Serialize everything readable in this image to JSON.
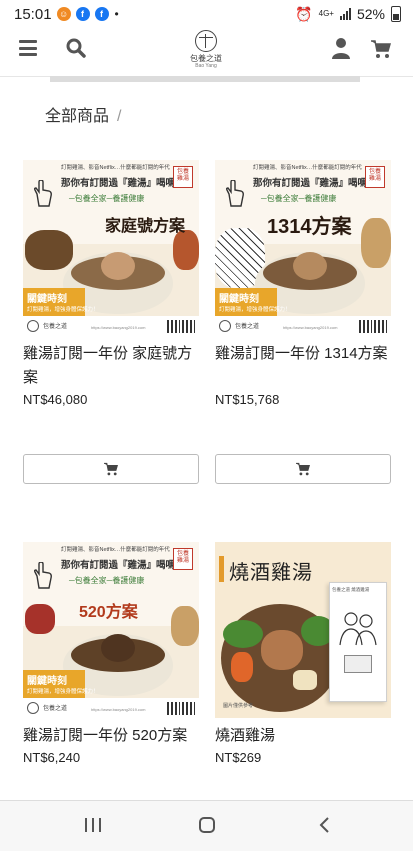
{
  "status_bar": {
    "time": "15:01",
    "network": "4G+",
    "battery": "52%"
  },
  "header": {
    "logo_cn": "包養之道",
    "logo_en": "Bao Yang"
  },
  "breadcrumb": {
    "label": "全部商品",
    "separator": "/"
  },
  "products": [
    {
      "name": "雞湯訂閱一年份 家庭號方案",
      "price": "NT$46,080",
      "image": {
        "line1": "訂閱雞湯、影音Netflix…什麼都能訂閱的年代",
        "line2": "那你有訂閱過『雞湯』喝嗎？",
        "line3": "─包養全家─養護健康",
        "badge": "包養 雞湯",
        "title": "家庭號方案",
        "flag_title": "關鍵時刻",
        "flag_sub": "訂閱雞湯，增強身體保護力！",
        "foot_logo": "包養之道",
        "foot_url": "https://www.baoyang2019.com"
      }
    },
    {
      "name": "雞湯訂閱一年份 1314方案",
      "price": "NT$15,768",
      "image": {
        "line1": "訂閱雞湯、影音Netflix…什麼都能訂閱的年代",
        "line2": "那你有訂閱過『雞湯』喝嗎？",
        "line3": "─包養全家─養護健康",
        "badge": "包養 雞湯",
        "title": "1314方案",
        "flag_title": "關鍵時刻",
        "flag_sub": "訂閱雞湯，增強身體保護力！",
        "foot_logo": "包養之道",
        "foot_url": "https://www.baoyang2019.com"
      }
    },
    {
      "name": "雞湯訂閱一年份 520方案",
      "price": "NT$6,240",
      "image": {
        "line1": "訂閱雞湯、影音Netflix…什麼都能訂閱的年代",
        "line2": "那你有訂閱過『雞湯』喝嗎？",
        "line3": "─包養全家─養護健康",
        "badge": "包養 雞湯",
        "title": "520方案",
        "flag_title": "關鍵時刻",
        "flag_sub": "訂閱雞湯，增強身體保護力！",
        "foot_logo": "包養之道",
        "foot_url": "https://www.baoyang2019.com"
      }
    },
    {
      "name": "燒酒雞湯",
      "price": "NT$269",
      "image": {
        "title": "燒酒雞湯",
        "box_label": "包養之道  燒酒雞湯",
        "note": "圖片僅供參考"
      }
    }
  ],
  "colors": {
    "accent_orange": "#e8a62a",
    "badge_red": "#c0392b",
    "green_text": "#3e7d3a"
  },
  "icons": {
    "menu": "hamburger-menu-icon",
    "search": "search-icon",
    "user": "user-icon",
    "cart": "shopping-cart-icon"
  }
}
